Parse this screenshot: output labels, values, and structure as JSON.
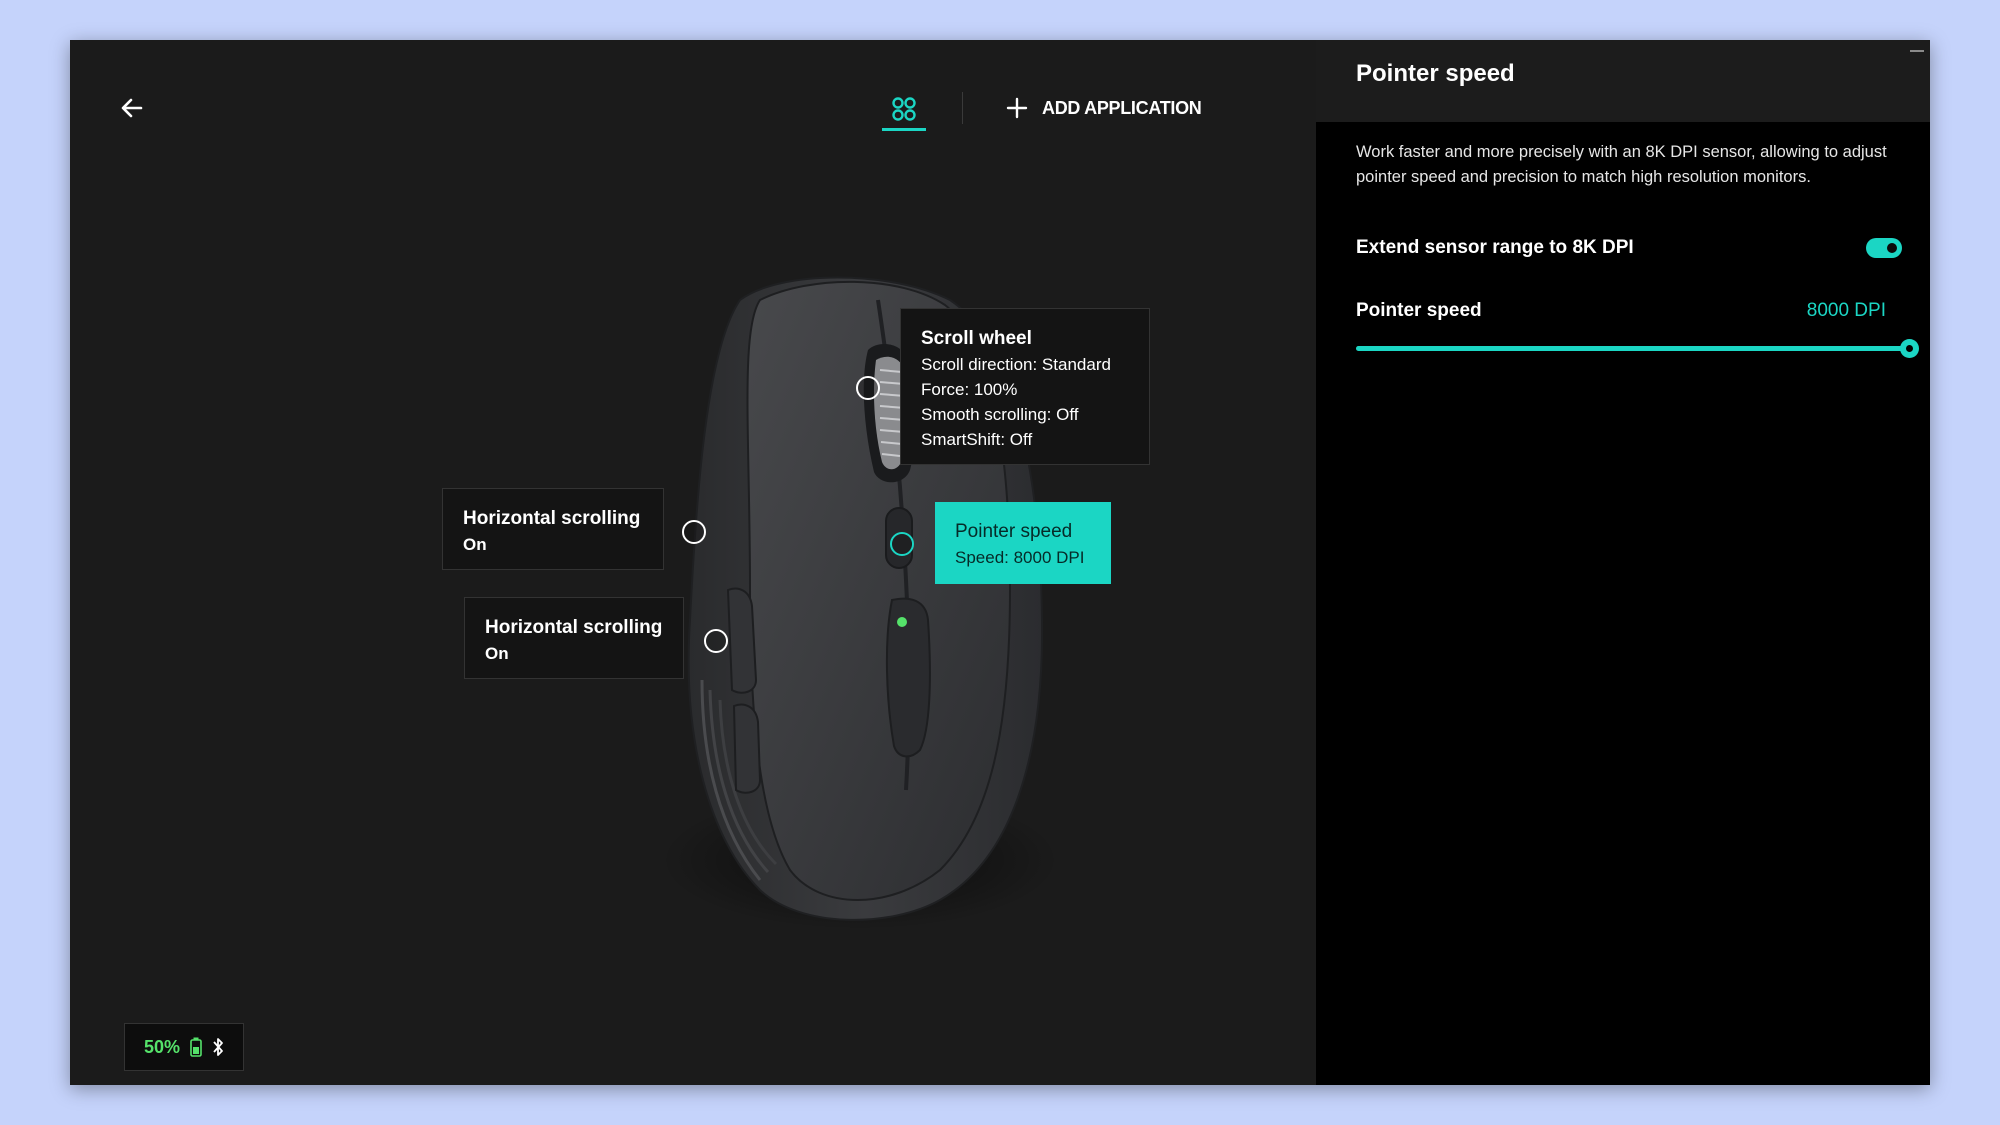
{
  "toolbar": {
    "add_application": "ADD APPLICATION"
  },
  "callouts": {
    "scroll_wheel": {
      "title": "Scroll wheel",
      "lines": [
        "Scroll direction: Standard",
        "Force: 100%",
        "Smooth scrolling: Off",
        "SmartShift: Off"
      ]
    },
    "horizontal_1": {
      "title": "Horizontal scrolling",
      "value": "On"
    },
    "horizontal_2": {
      "title": "Horizontal scrolling",
      "value": "On"
    },
    "pointer_speed": {
      "title": "Pointer speed",
      "value": "Speed: 8000 DPI"
    }
  },
  "status": {
    "battery": "50%"
  },
  "panel": {
    "title": "Pointer speed",
    "description": "Work faster and more precisely with an 8K DPI sensor, allowing to adjust pointer speed and precision to match high resolution monitors.",
    "toggle_label": "Extend sensor range to 8K DPI",
    "toggle_on": true,
    "speed_label": "Pointer speed",
    "speed_value": "8000 DPI",
    "speed_fraction": 1.0
  },
  "colors": {
    "accent": "#1bd6c4",
    "battery": "#55e26a",
    "background": "#1b1b1b",
    "panel": "#000000"
  },
  "icons": {
    "back": "arrow-left-icon",
    "apps": "apps-grid-icon",
    "add": "plus-icon",
    "battery": "battery-icon",
    "bluetooth": "bluetooth-icon"
  }
}
